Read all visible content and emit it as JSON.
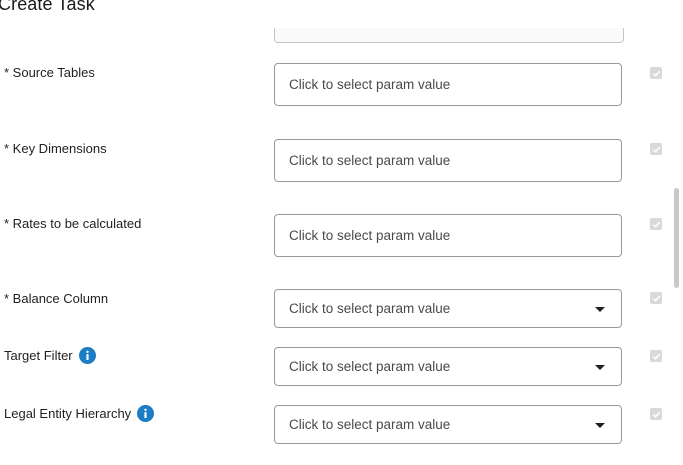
{
  "dialog": {
    "title": "Create Task"
  },
  "form": {
    "placeholder": "Click to select param value",
    "fields": [
      {
        "label": "* Source Tables",
        "type": "text",
        "info": false,
        "checked": true
      },
      {
        "label": "* Key Dimensions",
        "type": "text",
        "info": false,
        "checked": true
      },
      {
        "label": "* Rates to be calculated",
        "type": "text",
        "info": false,
        "checked": true
      },
      {
        "label": "* Balance Column",
        "type": "dropdown",
        "info": false,
        "checked": true
      },
      {
        "label": "Target Filter",
        "type": "dropdown",
        "info": true,
        "checked": true
      },
      {
        "label": "Legal Entity Hierarchy",
        "type": "dropdown",
        "info": true,
        "checked": true
      }
    ]
  },
  "icons": {
    "info": "info-circle-icon",
    "caret": "caret-down-icon",
    "check": "checkmark-icon"
  },
  "colors": {
    "info_icon": "#1c7cc4",
    "checkbox_disabled": "#d9d9d9",
    "field_border": "#9a9a9a"
  }
}
